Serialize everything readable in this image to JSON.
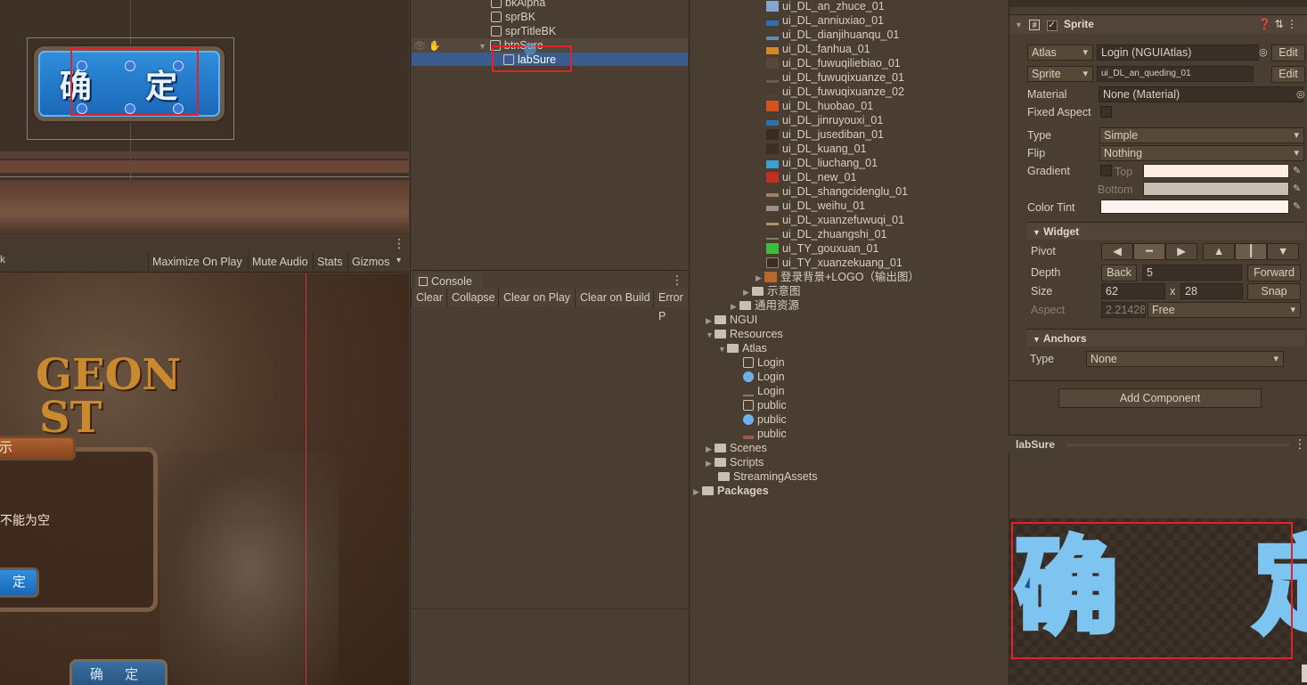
{
  "scene": {
    "button_text": "确 定"
  },
  "game_toolbar": {
    "maximize": "Maximize On Play",
    "mute": "Mute Audio",
    "stats": "Stats",
    "gizmos": "Gizmos"
  },
  "game": {
    "logo_line1": "GEON",
    "logo_line2": "ST",
    "dialog_title": "示",
    "dialog_msg": "不能为空",
    "ok_small": "定",
    "ok_bottom": "确 定"
  },
  "hierarchy": {
    "items": [
      {
        "label": "bkAlpha"
      },
      {
        "label": "sprBK"
      },
      {
        "label": "sprTitleBK"
      },
      {
        "label": "btnSure"
      },
      {
        "label": "labSure"
      }
    ]
  },
  "console": {
    "tab": "Console",
    "buttons": [
      "Clear",
      "Collapse",
      "Clear on Play",
      "Clear on Build",
      "Error P"
    ]
  },
  "project": {
    "sprites": [
      "ui_DL_an_zhuce_01",
      "ui_DL_anniuxiao_01",
      "ui_DL_dianjihuanqu_01",
      "ui_DL_fanhua_01",
      "ui_DL_fuwuqiliebiao_01",
      "ui_DL_fuwuqixuanze_01",
      "ui_DL_fuwuqixuanze_02",
      "ui_DL_huobao_01",
      "ui_DL_jinruyouxi_01",
      "ui_DL_jusediban_01",
      "ui_DL_kuang_01",
      "ui_DL_liuchang_01",
      "ui_DL_new_01",
      "ui_DL_shangcidenglu_01",
      "ui_DL_weihu_01",
      "ui_DL_xuanzefuwuqi_01",
      "ui_DL_zhuangshi_01",
      "ui_TY_gouxuan_01",
      "ui_TY_xuanzekuang_01",
      "登录背景+LOGO（输出图）"
    ],
    "sub_folders": [
      "示意图",
      "通用资源"
    ],
    "tree": {
      "ngui": "NGUI",
      "resources": "Resources",
      "atlas": "Atlas",
      "atlas_items": [
        "Login",
        "Login",
        "Login",
        "public",
        "public",
        "public"
      ],
      "scenes": "Scenes",
      "scripts": "Scripts",
      "streaming": "StreamingAssets",
      "packages": "Packages"
    }
  },
  "inspector": {
    "component": "Sprite",
    "atlas_label": "Atlas",
    "atlas_value": "Login (NGUIAtlas)",
    "sprite_label": "Sprite",
    "sprite_value": "ui_DL_an_queding_01",
    "edit": "Edit",
    "material_label": "Material",
    "material_value": "None (Material)",
    "fixed_aspect": "Fixed Aspect",
    "type_label": "Type",
    "type_value": "Simple",
    "flip_label": "Flip",
    "flip_value": "Nothing",
    "gradient_label": "Gradient",
    "top": "Top",
    "bottom": "Bottom",
    "color_tint": "Color Tint",
    "widget_section": "Widget",
    "pivot": "Pivot",
    "depth_label": "Depth",
    "back": "Back",
    "depth_value": "5",
    "forward": "Forward",
    "size_label": "Size",
    "size_w": "62",
    "size_x": "x",
    "size_h": "28",
    "snap": "Snap",
    "aspect_label": "Aspect",
    "aspect_value": "2.21428",
    "aspect_mode": "Free",
    "anchors_section": "Anchors",
    "anchor_type_label": "Type",
    "anchor_type_value": "None",
    "add_component": "Add Component",
    "colors": {
      "tint": "#fff4ee",
      "gradient_top": "#ffece4",
      "gradient_bottom": "#c9bdb4"
    }
  },
  "preview": {
    "title": "labSure",
    "text": "确 定"
  }
}
